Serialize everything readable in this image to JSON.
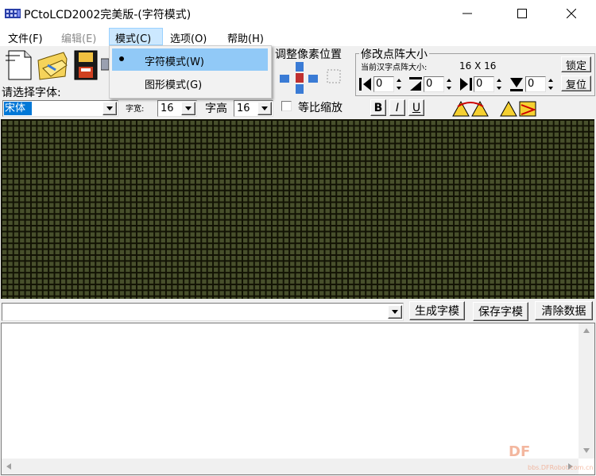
{
  "window": {
    "title": "PCtoLCD2002完美版-(字符模式)"
  },
  "menubar": {
    "items": [
      {
        "label": "文件(F)"
      },
      {
        "label": "编辑(E)"
      },
      {
        "label": "模式(C)"
      },
      {
        "label": "选项(O)"
      },
      {
        "label": "帮助(H)"
      }
    ]
  },
  "mode_menu": {
    "items": [
      {
        "label": "字符模式(W)",
        "checked": true
      },
      {
        "label": "图形模式(G)",
        "checked": false
      }
    ]
  },
  "toolbar": {
    "font_select_label": "请选择字体:",
    "font_value": "宋体",
    "char_width_label": "字宽:",
    "char_width_value": "16",
    "char_height_label": "字高",
    "char_height_value": "16",
    "proportional_label": "等比缩放",
    "bold_label": "B",
    "italic_label": "I",
    "underline_label": "U",
    "pixel_adjust_title": "调整像素位置",
    "matrix_title": "修改点阵大小",
    "current_size_label": "当前汉字点阵大小:",
    "current_size_value": "16 X 16",
    "lock_label": "锁定",
    "reset_label": "复位",
    "spin_values": [
      "0",
      "0",
      "0",
      "0"
    ]
  },
  "bottom": {
    "input_value": "",
    "generate_label": "生成字模",
    "save_label": "保存字模",
    "clear_label": "清除数据"
  },
  "watermark": {
    "text": "DF",
    "subtext": "bbs.DFRobot.com.cn"
  }
}
